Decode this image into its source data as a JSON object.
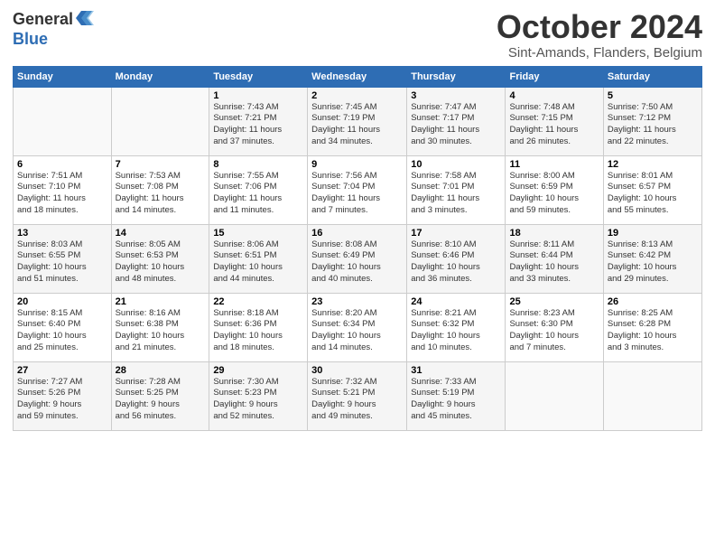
{
  "header": {
    "logo_general": "General",
    "logo_blue": "Blue",
    "title": "October 2024",
    "subtitle": "Sint-Amands, Flanders, Belgium"
  },
  "days_of_week": [
    "Sunday",
    "Monday",
    "Tuesday",
    "Wednesday",
    "Thursday",
    "Friday",
    "Saturday"
  ],
  "weeks": [
    [
      {
        "day": "",
        "info": ""
      },
      {
        "day": "",
        "info": ""
      },
      {
        "day": "1",
        "info": "Sunrise: 7:43 AM\nSunset: 7:21 PM\nDaylight: 11 hours\nand 37 minutes."
      },
      {
        "day": "2",
        "info": "Sunrise: 7:45 AM\nSunset: 7:19 PM\nDaylight: 11 hours\nand 34 minutes."
      },
      {
        "day": "3",
        "info": "Sunrise: 7:47 AM\nSunset: 7:17 PM\nDaylight: 11 hours\nand 30 minutes."
      },
      {
        "day": "4",
        "info": "Sunrise: 7:48 AM\nSunset: 7:15 PM\nDaylight: 11 hours\nand 26 minutes."
      },
      {
        "day": "5",
        "info": "Sunrise: 7:50 AM\nSunset: 7:12 PM\nDaylight: 11 hours\nand 22 minutes."
      }
    ],
    [
      {
        "day": "6",
        "info": "Sunrise: 7:51 AM\nSunset: 7:10 PM\nDaylight: 11 hours\nand 18 minutes."
      },
      {
        "day": "7",
        "info": "Sunrise: 7:53 AM\nSunset: 7:08 PM\nDaylight: 11 hours\nand 14 minutes."
      },
      {
        "day": "8",
        "info": "Sunrise: 7:55 AM\nSunset: 7:06 PM\nDaylight: 11 hours\nand 11 minutes."
      },
      {
        "day": "9",
        "info": "Sunrise: 7:56 AM\nSunset: 7:04 PM\nDaylight: 11 hours\nand 7 minutes."
      },
      {
        "day": "10",
        "info": "Sunrise: 7:58 AM\nSunset: 7:01 PM\nDaylight: 11 hours\nand 3 minutes."
      },
      {
        "day": "11",
        "info": "Sunrise: 8:00 AM\nSunset: 6:59 PM\nDaylight: 10 hours\nand 59 minutes."
      },
      {
        "day": "12",
        "info": "Sunrise: 8:01 AM\nSunset: 6:57 PM\nDaylight: 10 hours\nand 55 minutes."
      }
    ],
    [
      {
        "day": "13",
        "info": "Sunrise: 8:03 AM\nSunset: 6:55 PM\nDaylight: 10 hours\nand 51 minutes."
      },
      {
        "day": "14",
        "info": "Sunrise: 8:05 AM\nSunset: 6:53 PM\nDaylight: 10 hours\nand 48 minutes."
      },
      {
        "day": "15",
        "info": "Sunrise: 8:06 AM\nSunset: 6:51 PM\nDaylight: 10 hours\nand 44 minutes."
      },
      {
        "day": "16",
        "info": "Sunrise: 8:08 AM\nSunset: 6:49 PM\nDaylight: 10 hours\nand 40 minutes."
      },
      {
        "day": "17",
        "info": "Sunrise: 8:10 AM\nSunset: 6:46 PM\nDaylight: 10 hours\nand 36 minutes."
      },
      {
        "day": "18",
        "info": "Sunrise: 8:11 AM\nSunset: 6:44 PM\nDaylight: 10 hours\nand 33 minutes."
      },
      {
        "day": "19",
        "info": "Sunrise: 8:13 AM\nSunset: 6:42 PM\nDaylight: 10 hours\nand 29 minutes."
      }
    ],
    [
      {
        "day": "20",
        "info": "Sunrise: 8:15 AM\nSunset: 6:40 PM\nDaylight: 10 hours\nand 25 minutes."
      },
      {
        "day": "21",
        "info": "Sunrise: 8:16 AM\nSunset: 6:38 PM\nDaylight: 10 hours\nand 21 minutes."
      },
      {
        "day": "22",
        "info": "Sunrise: 8:18 AM\nSunset: 6:36 PM\nDaylight: 10 hours\nand 18 minutes."
      },
      {
        "day": "23",
        "info": "Sunrise: 8:20 AM\nSunset: 6:34 PM\nDaylight: 10 hours\nand 14 minutes."
      },
      {
        "day": "24",
        "info": "Sunrise: 8:21 AM\nSunset: 6:32 PM\nDaylight: 10 hours\nand 10 minutes."
      },
      {
        "day": "25",
        "info": "Sunrise: 8:23 AM\nSunset: 6:30 PM\nDaylight: 10 hours\nand 7 minutes."
      },
      {
        "day": "26",
        "info": "Sunrise: 8:25 AM\nSunset: 6:28 PM\nDaylight: 10 hours\nand 3 minutes."
      }
    ],
    [
      {
        "day": "27",
        "info": "Sunrise: 7:27 AM\nSunset: 5:26 PM\nDaylight: 9 hours\nand 59 minutes."
      },
      {
        "day": "28",
        "info": "Sunrise: 7:28 AM\nSunset: 5:25 PM\nDaylight: 9 hours\nand 56 minutes."
      },
      {
        "day": "29",
        "info": "Sunrise: 7:30 AM\nSunset: 5:23 PM\nDaylight: 9 hours\nand 52 minutes."
      },
      {
        "day": "30",
        "info": "Sunrise: 7:32 AM\nSunset: 5:21 PM\nDaylight: 9 hours\nand 49 minutes."
      },
      {
        "day": "31",
        "info": "Sunrise: 7:33 AM\nSunset: 5:19 PM\nDaylight: 9 hours\nand 45 minutes."
      },
      {
        "day": "",
        "info": ""
      },
      {
        "day": "",
        "info": ""
      }
    ]
  ]
}
